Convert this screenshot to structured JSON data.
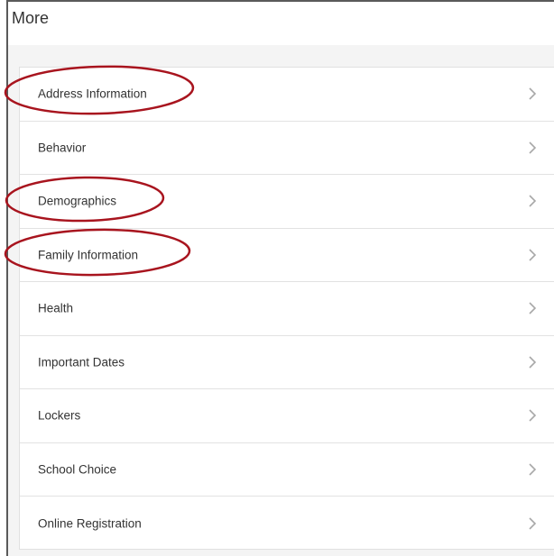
{
  "header": {
    "title": "More"
  },
  "menu": {
    "items": [
      {
        "label": "Address Information",
        "highlighted": true
      },
      {
        "label": "Behavior",
        "highlighted": false
      },
      {
        "label": "Demographics",
        "highlighted": true
      },
      {
        "label": "Family Information",
        "highlighted": true
      },
      {
        "label": "Health",
        "highlighted": false
      },
      {
        "label": "Important Dates",
        "highlighted": false
      },
      {
        "label": "Lockers",
        "highlighted": false
      },
      {
        "label": "School Choice",
        "highlighted": false
      },
      {
        "label": "Online Registration",
        "highlighted": false
      }
    ],
    "chevron_icon": "chevron-right-icon"
  },
  "colors": {
    "annotation": "#a8141e",
    "chevron": "#a8a8a8",
    "divider": "#e2e2e2",
    "background_band": "#f4f4f4"
  }
}
